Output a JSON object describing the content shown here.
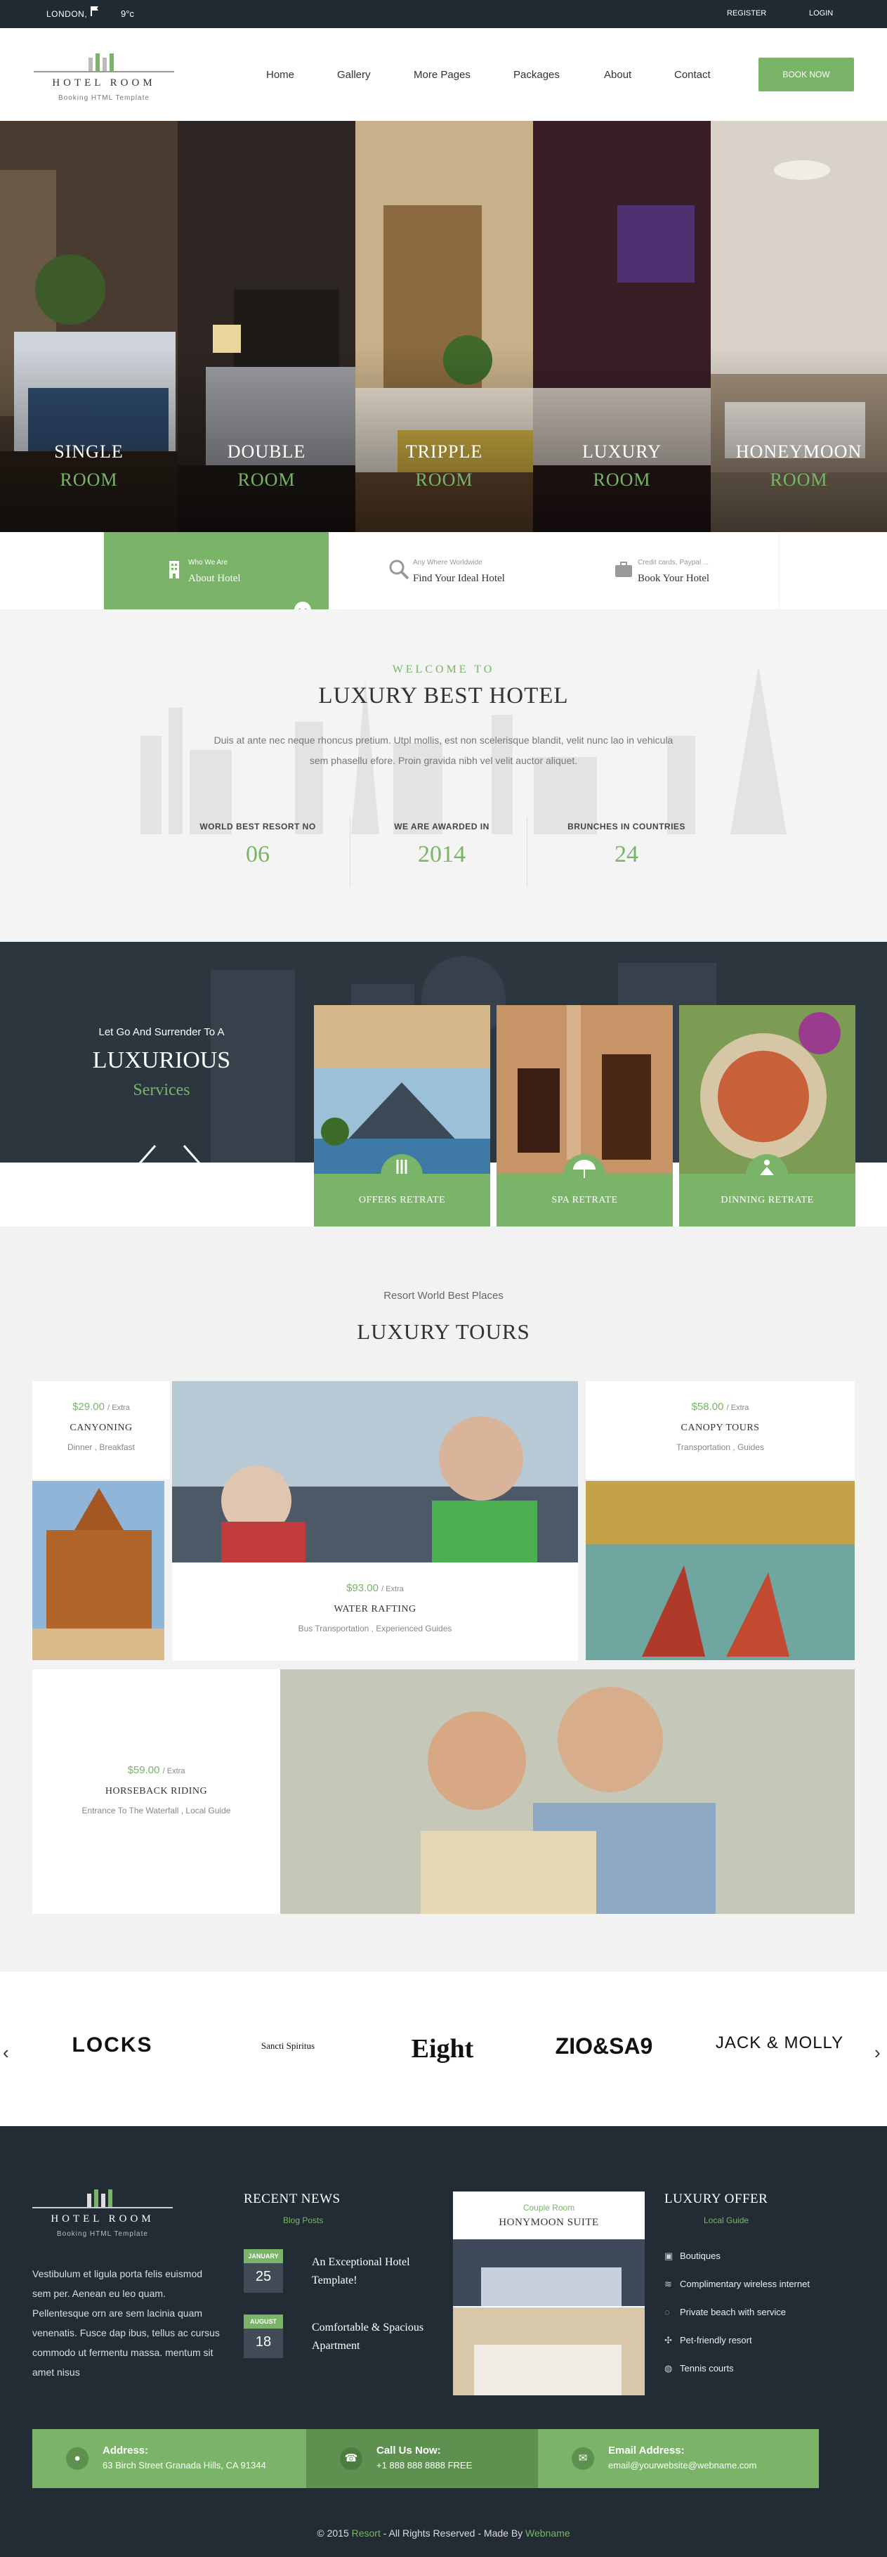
{
  "topbar": {
    "location": "LONDON,",
    "temperature": "9°c",
    "register": "REGISTER",
    "login": "LOGIN"
  },
  "brand": {
    "name": "HOTEL ROOM",
    "tagline": "Booking HTML Template"
  },
  "nav": {
    "items": [
      "Home",
      "Gallery",
      "More Pages",
      "Packages",
      "About",
      "Contact"
    ],
    "book_now": "BOOK NOW"
  },
  "rooms": [
    {
      "line1": "SINGLE",
      "line2": "ROOM"
    },
    {
      "line1": "DOUBLE",
      "line2": "ROOM"
    },
    {
      "line1": "TRIPPLE",
      "line2": "ROOM"
    },
    {
      "line1": "LUXURY",
      "line2": "ROOM"
    },
    {
      "line1": "HONEYMOON",
      "line2": "ROOM"
    }
  ],
  "info_tabs": [
    {
      "small": "Who We Are",
      "title": "About Hotel"
    },
    {
      "small": "Any Where Worldwide",
      "title": "Find Your Ideal Hotel"
    },
    {
      "small": "Credit cards, Paypal ...",
      "title": "Book Your Hotel"
    }
  ],
  "welcome": {
    "kicker": "WELCOME TO",
    "title": "LUXURY BEST HOTEL",
    "text": "Duis at ante nec neque rhoncus pretium. Utpl mollis, est non scelerisque blandit, velit nunc lao in vehicula sem phasellu efore. Proin gravida nibh vel velit auctor aliquet.",
    "stats": [
      {
        "label": "WORLD BEST RESORT NO",
        "value": "06"
      },
      {
        "label": "WE ARE AWARDED IN",
        "value": "2014"
      },
      {
        "label": "BRUNCHES IN COUNTRIES",
        "value": "24"
      }
    ]
  },
  "services": {
    "intro": "Let Go And Surrender To A",
    "title": "LUXURIOUS",
    "subtitle": "Services",
    "cards": [
      {
        "label": "OFFERS RETRATE",
        "icon": "resort-icon"
      },
      {
        "label": "SPA RETRATE",
        "icon": "umbrella-icon"
      },
      {
        "label": "DINNING RETRATE",
        "icon": "meditation-icon"
      }
    ]
  },
  "tours": {
    "kicker": "Resort World Best Places",
    "title": "LUXURY TOURS",
    "items": [
      {
        "price": "$29.00",
        "unit": "/ Extra",
        "name": "CANYONING",
        "info": "Dinner , Breakfast"
      },
      {
        "price": "$93.00",
        "unit": "/ Extra",
        "name": "WATER RAFTING",
        "info": "Bus Transportation , Experienced Guides"
      },
      {
        "price": "$58.00",
        "unit": "/ Extra",
        "name": "CANOPY TOURS",
        "info": "Transportation , Guides"
      },
      {
        "price": "$59.00",
        "unit": "/ Extra",
        "name": "HORSEBACK RIDING",
        "info": "Entrance To The Waterfall , Local Guide"
      }
    ]
  },
  "brands": [
    "LOCKS",
    "Sancti Spiritus",
    "Eight",
    "ZIO&SA9",
    "JACK & MOLLY"
  ],
  "footer": {
    "about": "Vestibulum et ligula porta felis euismod sem per. Aenean eu leo quam. Pellentesque orn are sem lacinia quam venenatis. Fusce dap ibus, tellus ac cursus commodo ut fermentu massa. mentum sit amet nisus",
    "news_title": "RECENT NEWS",
    "news_sub": "Blog Posts",
    "news": [
      {
        "month": "JANUARY",
        "day": "25",
        "title": "An Exceptional Hotel Template!"
      },
      {
        "month": "AUGUST",
        "day": "18",
        "title": "Comfortable & Spacious Apartment"
      }
    ],
    "suite_kicker": "Couple Room",
    "suite_name": "HONYMOON SUITE",
    "offer_title": "LUXURY OFFER",
    "offer_sub": "Local Guide",
    "offers": [
      "Boutiques",
      "Complimentary wireless internet",
      "Private beach with service",
      "Pet-friendly resort",
      "Tennis courts"
    ],
    "contact": [
      {
        "label": "Address:",
        "value": "63 Birch Street Granada Hills, CA 91344"
      },
      {
        "label": "Call Us Now:",
        "value": "+1 888 888 8888 FREE"
      },
      {
        "label": "Email Address:",
        "value": "email@yourwebsite@webname.com"
      }
    ],
    "copyright": "© 2015",
    "copyright_brand": "Resort",
    "copyright_mid": "- All Rights Reserved - Made By",
    "copyright_author": "Webname"
  },
  "colors": {
    "accent": "#79b468",
    "dark": "#232c34",
    "topbar": "#1f2a33"
  }
}
